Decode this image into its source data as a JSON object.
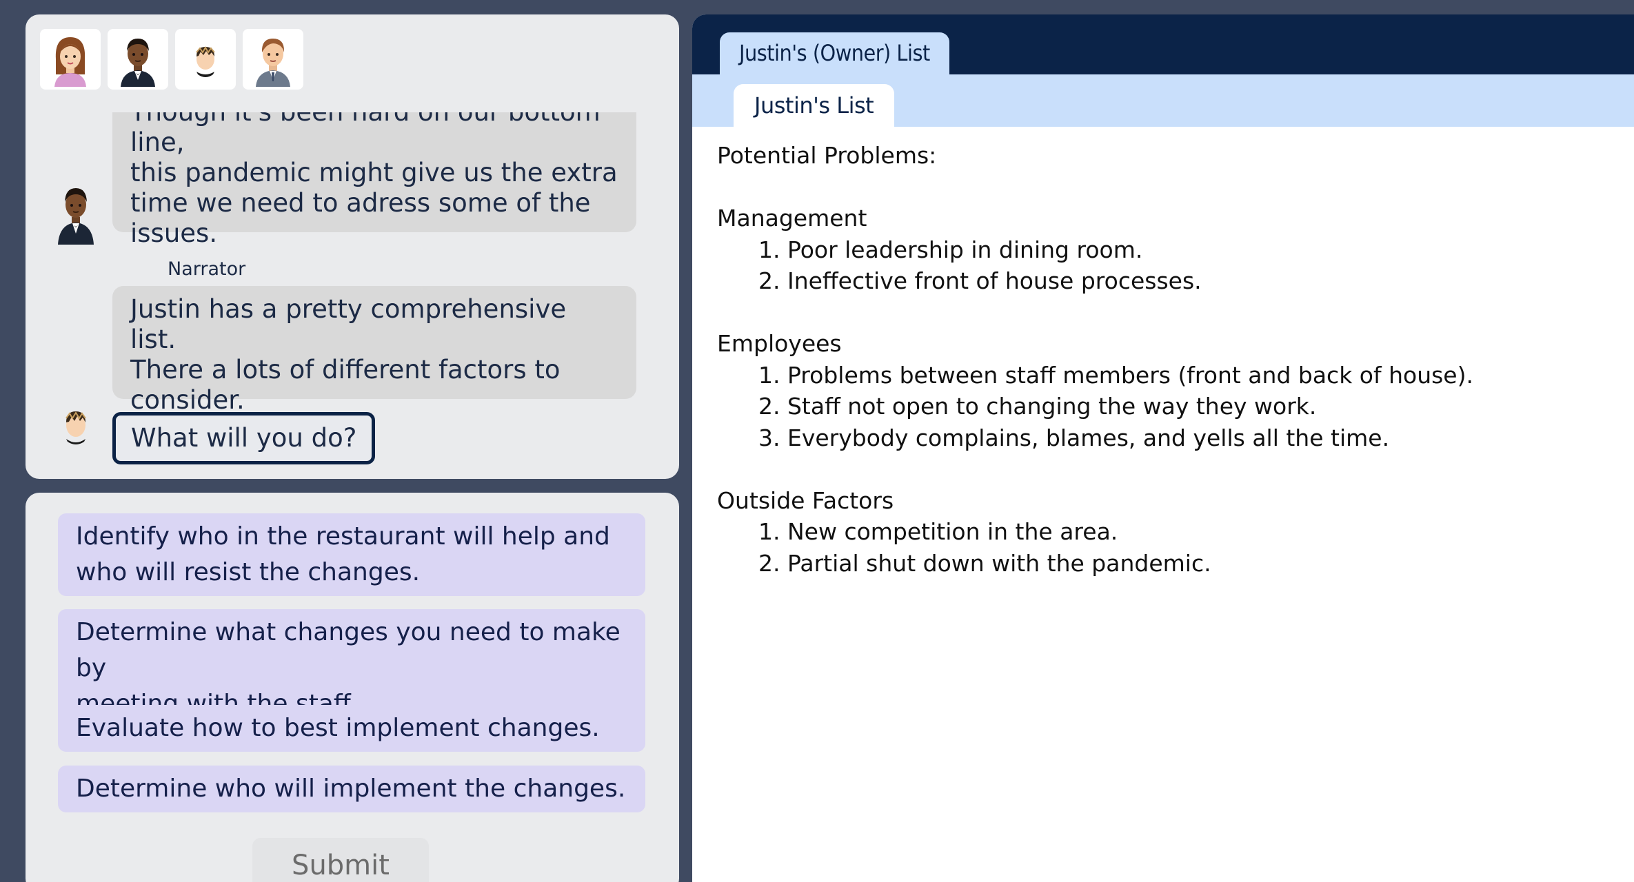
{
  "chat": {
    "avatars": [
      "woman-avatar-icon",
      "man-dark-suit-avatar-icon",
      "player-avatar-icon",
      "man-suit-avatar-icon"
    ],
    "messages": [
      {
        "speaker": "",
        "lines": [
          "Though it's been hard on our bottom line,",
          "this pandemic might give us the extra",
          "time we need to adress some of the",
          "issues."
        ]
      },
      {
        "speaker": "Narrator",
        "lines": [
          "Justin has a pretty comprehensive list.",
          "There a lots of different factors to",
          "consider."
        ]
      }
    ],
    "prompt": "What will you do?"
  },
  "choices": [
    {
      "lines": [
        "Identify who in the restaurant will help and",
        "who will resist the changes."
      ]
    },
    {
      "lines": [
        "Determine what changes you need to make by",
        "meeting with the staff."
      ]
    },
    {
      "lines": [
        "Evaluate how to best implement changes."
      ]
    },
    {
      "lines": [
        "Determine who will implement the changes."
      ]
    }
  ],
  "submit_label": "Submit",
  "document": {
    "tab_owner": "Justin's (Owner) List",
    "tab_list": "Justin's List",
    "title": "Potential Problems:",
    "sections": [
      {
        "heading": "Management",
        "items": [
          "1. Poor leadership in dining room.",
          "2. Ineffective front of house processes."
        ]
      },
      {
        "heading": "Employees",
        "items": [
          "1. Problems between staff members (front and back of house).",
          "2. Staff not open to changing the way they work.",
          "3. Everybody complains, blames, and yells all the time."
        ]
      },
      {
        "heading": "Outside Factors",
        "items": [
          "1. New competition in the area.",
          "2. Partial shut down with the pandemic."
        ]
      }
    ]
  },
  "colors": {
    "background": "#3f4a61",
    "panel": "#eaebed",
    "bubble": "#d9d9d9",
    "choice": "#dad6f4",
    "nav_dark": "#0b2348",
    "nav_light": "#c9dffb"
  }
}
